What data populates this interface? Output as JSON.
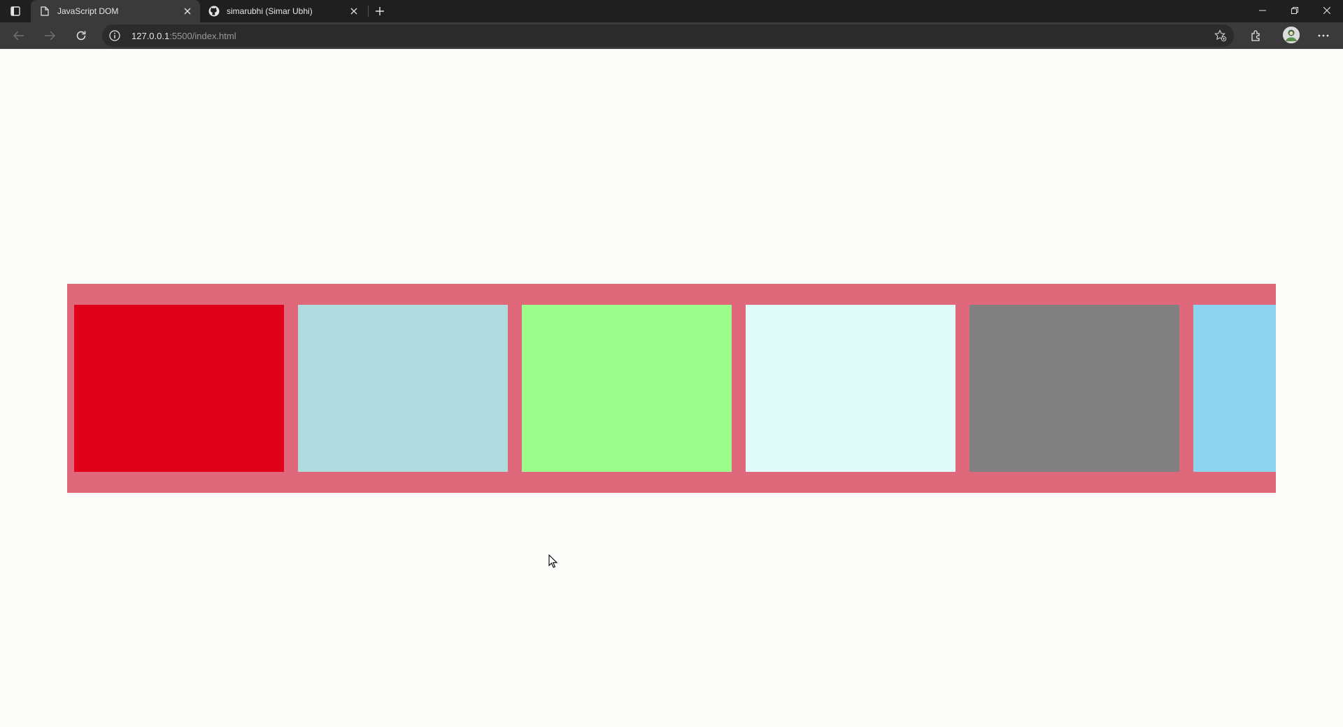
{
  "browser": {
    "tabs": [
      {
        "title": "JavaScript DOM",
        "icon": "page-icon",
        "active": true
      },
      {
        "title": "simarubhi (Simar Ubhi)",
        "icon": "github-icon",
        "active": false
      }
    ],
    "address": {
      "host": "127.0.0.1",
      "rest": ":5500/index.html"
    },
    "colors": {
      "titlebar": "#1f1f1f",
      "toolbar": "#3a3a3a",
      "addressbar": "#2b2b2b"
    }
  },
  "page": {
    "background": "#fbfbfa",
    "strip_color": "#e0687b",
    "boxes": [
      {
        "color": "#e1001a"
      },
      {
        "color": "#b0dce0"
      },
      {
        "color": "#9cfd8f"
      },
      {
        "color": "#e0fbfa"
      },
      {
        "color": "#808080"
      },
      {
        "color": "#8ed3ef"
      }
    ]
  }
}
